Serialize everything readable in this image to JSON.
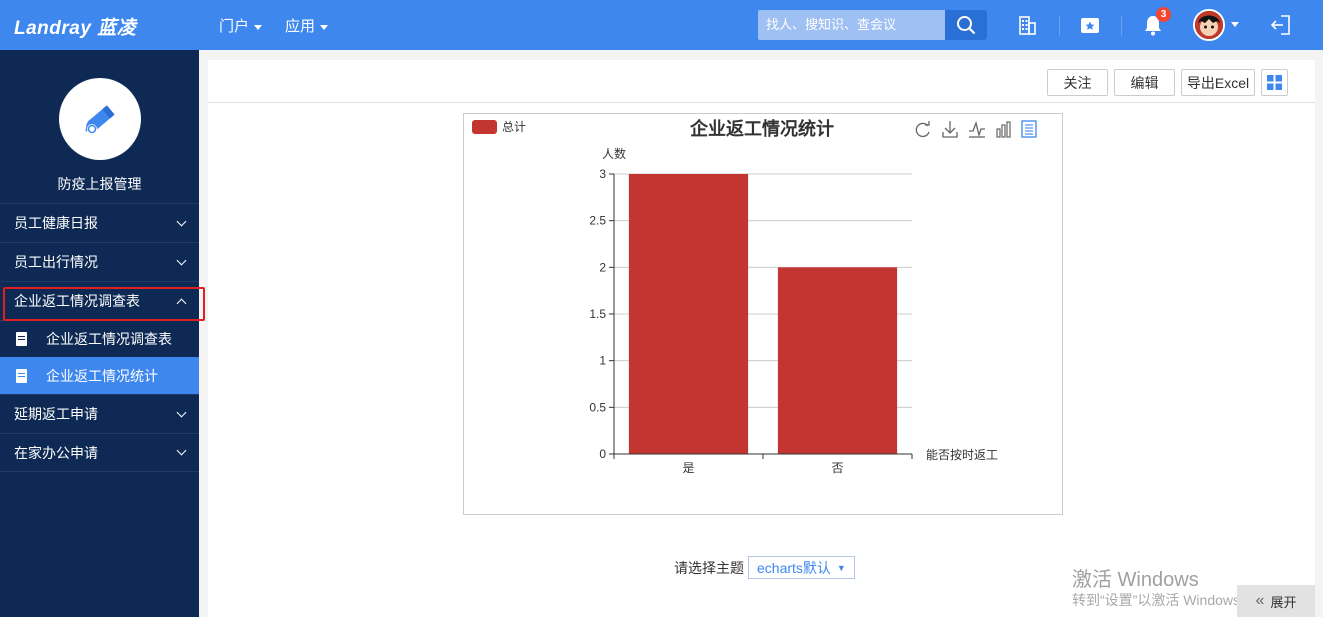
{
  "header": {
    "logo": "Landray 蓝凌",
    "nav": [
      {
        "label": "门户"
      },
      {
        "label": "应用"
      }
    ],
    "search_placeholder": "找人、搜知识、查会议",
    "notification_count": "3"
  },
  "sidebar": {
    "module_title": "防疫上报管理",
    "items": [
      {
        "label": "员工健康日报",
        "expanded": false
      },
      {
        "label": "员工出行情况",
        "expanded": false
      },
      {
        "label": "企业返工情况调查表",
        "expanded": true
      },
      {
        "label": "延期返工申请",
        "expanded": false
      },
      {
        "label": "在家办公申请",
        "expanded": false
      }
    ],
    "sub_items": [
      {
        "label": "企业返工情况调查表",
        "active": false
      },
      {
        "label": "企业返工情况统计",
        "active": true
      }
    ]
  },
  "toolbar": {
    "follow": "关注",
    "edit": "编辑",
    "export": "导出Excel"
  },
  "chart_data": {
    "type": "bar",
    "title": "企业返工情况统计",
    "legend": [
      "总计"
    ],
    "legend_position": "top-left",
    "ylabel": "人数",
    "xlabel": "能否按时返工",
    "categories": [
      "是",
      "否"
    ],
    "series": [
      {
        "name": "总计",
        "values": [
          3,
          2
        ],
        "color": "#c23531"
      }
    ],
    "ylim": [
      0,
      3
    ],
    "yticks": [
      "0",
      "0.5",
      "1",
      "1.5",
      "2",
      "2.5",
      "3"
    ],
    "grid": true
  },
  "theme": {
    "label": "请选择主题",
    "selected": "echarts默认"
  },
  "watermark": {
    "line1": "激活 Windows",
    "line2": "转到“设置”以激活 Windows。"
  },
  "expand_label": "展开"
}
